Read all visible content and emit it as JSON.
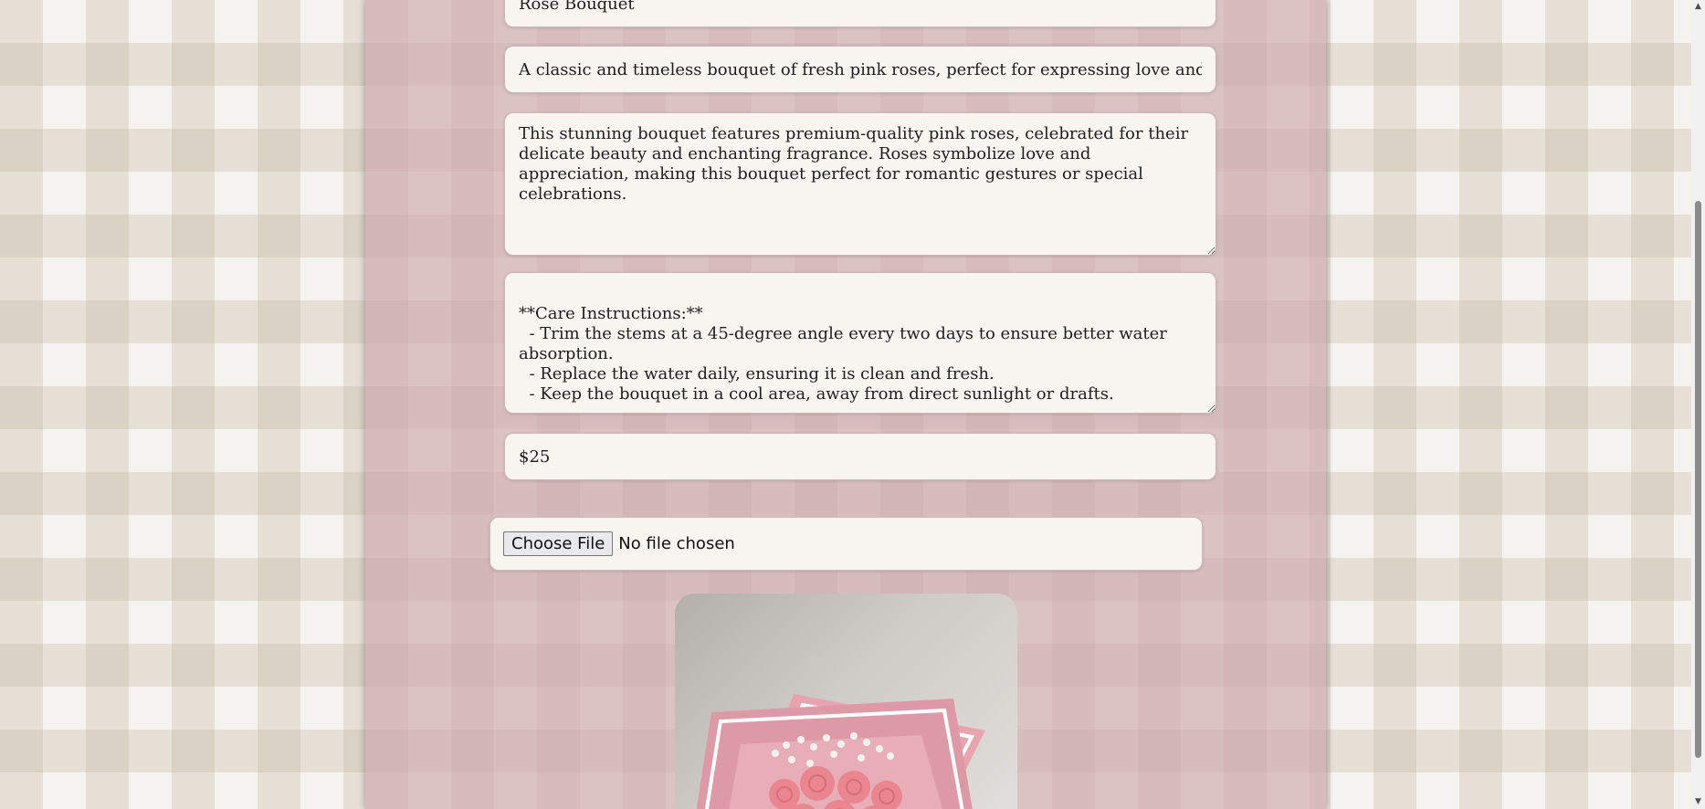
{
  "form": {
    "name_value": "Rose Bouquet",
    "summary_value": "A classic and timeless bouquet of fresh pink roses, perfect for expressing love and admiration.",
    "description_value": "This stunning bouquet features premium-quality pink roses, celebrated for their delicate beauty and enchanting fragrance. Roses symbolize love and appreciation, making this bouquet perfect for romantic gestures or special celebrations.",
    "care_value": "\n**Care Instructions:**\n  - Trim the stems at a 45-degree angle every two days to ensure better water absorption.\n  - Replace the water daily, ensuring it is clean and fresh.\n  - Keep the bouquet in a cool area, away from direct sunlight or drafts.",
    "price_value": "$25",
    "file_button_label": "Choose File",
    "file_status": "No file chosen"
  },
  "preview": {
    "icon": "bouquet-photo"
  },
  "colors": {
    "panel": "#dbc2c3",
    "field_background": "#f8f5f0",
    "page_check": "#e6ded3"
  }
}
